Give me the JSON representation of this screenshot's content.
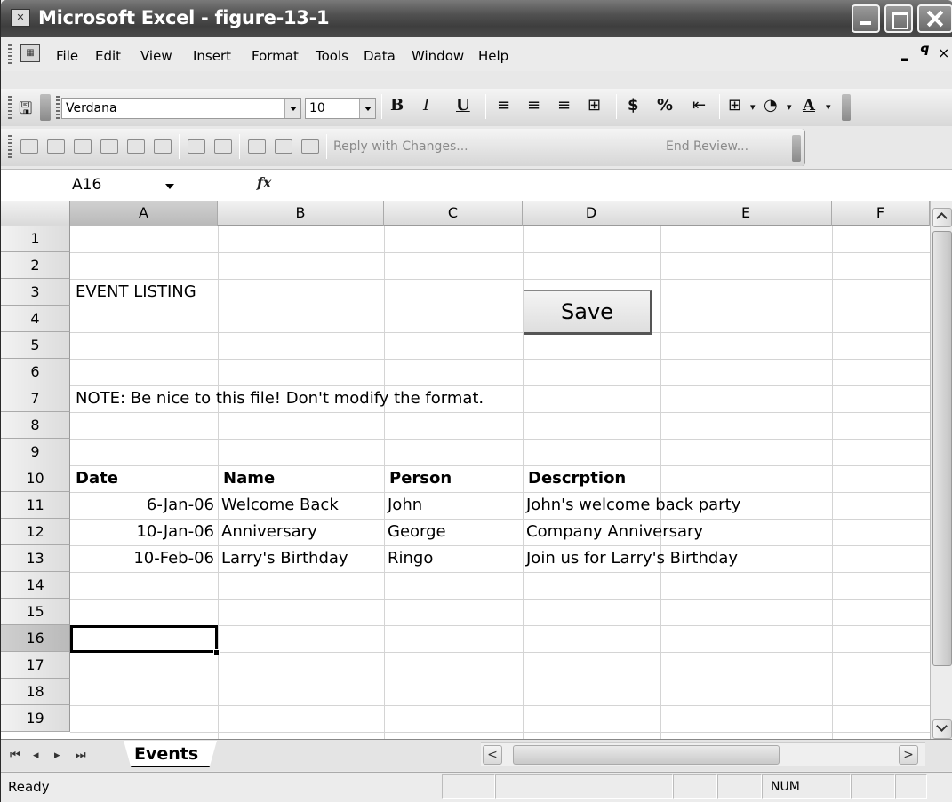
{
  "window": {
    "title": "Microsoft Excel - figure-13-1",
    "app_icon": "excel-icon"
  },
  "menu": {
    "items": [
      "File",
      "Edit",
      "View",
      "Insert",
      "Format",
      "Tools",
      "Data",
      "Window",
      "Help"
    ]
  },
  "format_toolbar": {
    "font_name": "Verdana",
    "font_size": "10",
    "bold": "B",
    "italic": "I",
    "underline": "U",
    "currency": "$",
    "percent": "%",
    "font_color_label": "A"
  },
  "review_toolbar": {
    "reply_label": "Reply with Changes...",
    "end_review_label": "End Review..."
  },
  "formula_bar": {
    "name_box": "A16",
    "fx_label": "fx",
    "formula": ""
  },
  "grid": {
    "columns": [
      "A",
      "B",
      "C",
      "D",
      "E",
      "F"
    ],
    "rows": [
      "1",
      "2",
      "3",
      "4",
      "5",
      "6",
      "7",
      "8",
      "9",
      "10",
      "11",
      "12",
      "13",
      "14",
      "15",
      "16",
      "17",
      "18",
      "19"
    ],
    "selected_cell": "A16",
    "cells": {
      "A3": "EVENT LISTING",
      "A7": "NOTE: Be nice to this file!  Don't modify the format.",
      "A10": "Date",
      "B10": "Name",
      "C10": "Person",
      "D10": "Descrption",
      "A11": "6-Jan-06",
      "B11": "Welcome Back",
      "C11": "John",
      "D11": "John's welcome back party",
      "A12": "10-Jan-06",
      "B12": "Anniversary",
      "C12": "George",
      "D12": "Company Anniversary",
      "A13": "10-Feb-06",
      "B13": "Larry's Birthday",
      "C13": "Ringo",
      "D13": "Join us for Larry's Birthday"
    }
  },
  "save_button": {
    "label": "Save"
  },
  "sheet_tabs": {
    "active": "Events"
  },
  "status_bar": {
    "status": "Ready",
    "num_lock": "NUM"
  }
}
